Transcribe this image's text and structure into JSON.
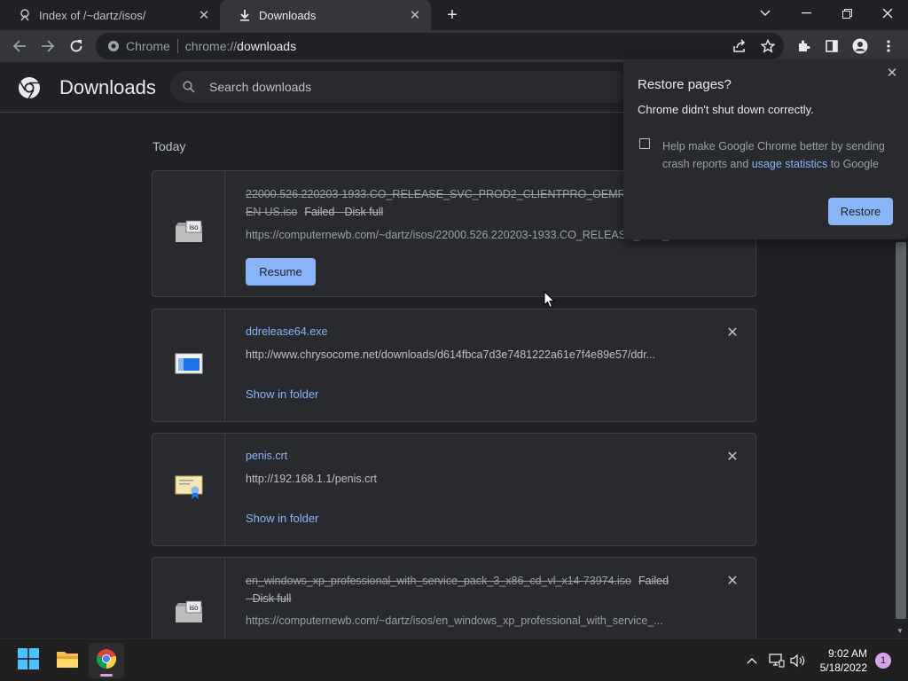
{
  "browser": {
    "tabs": [
      {
        "title": "Index of /~dartz/isos/",
        "active": false
      },
      {
        "title": "Downloads",
        "active": true
      }
    ],
    "omnibox": {
      "chip": "Chrome",
      "url_scheme": "chrome://",
      "url_host": "downloads"
    }
  },
  "downloads_page": {
    "title": "Downloads",
    "search_placeholder": "Search downloads",
    "section_date": "Today",
    "items": [
      {
        "filename": "22000.526.220203-1933.CO_RELEASE_SVC_PROD2_CLIENTPRO_OEMRET_X64FRE_EN-US.iso",
        "filename_line1": "22000.526.220203-1933.CO_RELEASE_SVC_PROD2_CLIENTPRO_OEMRE",
        "filename_line2": "EN-US.iso",
        "status": "Failed - Disk full",
        "url": "https://computernewb.com/~dartz/isos/22000.526.220203-1933.CO_RELEASE_SVC_PROD2_CLIENTPRO_OEMRET_X64FRE_EN-US.iso",
        "action": "Resume",
        "icon": "iso-file-icon"
      },
      {
        "filename": "ddrelease64.exe",
        "url": "http://www.chrysocome.net/downloads/d614fbca7d3e7481222a61e7f4e89e57/ddr...",
        "action": "Show in folder",
        "icon": "exe-file-icon"
      },
      {
        "filename": "penis.crt",
        "url": "http://192.168.1.1/penis.crt",
        "action": "Show in folder",
        "icon": "certificate-file-icon"
      },
      {
        "filename": "en_windows_xp_professional_with_service_pack_3_x86_cd_vl_x14-73974.iso",
        "status": "Failed",
        "status_line2": "- Disk full",
        "url": "https://computernewb.com/~dartz/isos/en_windows_xp_professional_with_service_...",
        "icon": "iso-file-icon"
      }
    ]
  },
  "restore_popup": {
    "title": "Restore pages?",
    "message": "Chrome didn't shut down correctly.",
    "checkbox_text_before": "Help make Google Chrome better by sending crash reports and ",
    "checkbox_link": "usage statistics",
    "checkbox_text_after": " to Google",
    "button": "Restore"
  },
  "taskbar": {
    "time": "9:02 AM",
    "date": "5/18/2022",
    "notification_count": "1"
  },
  "colors": {
    "accent": "#8ab4f8",
    "background": "#202124",
    "card": "#292a2d"
  }
}
